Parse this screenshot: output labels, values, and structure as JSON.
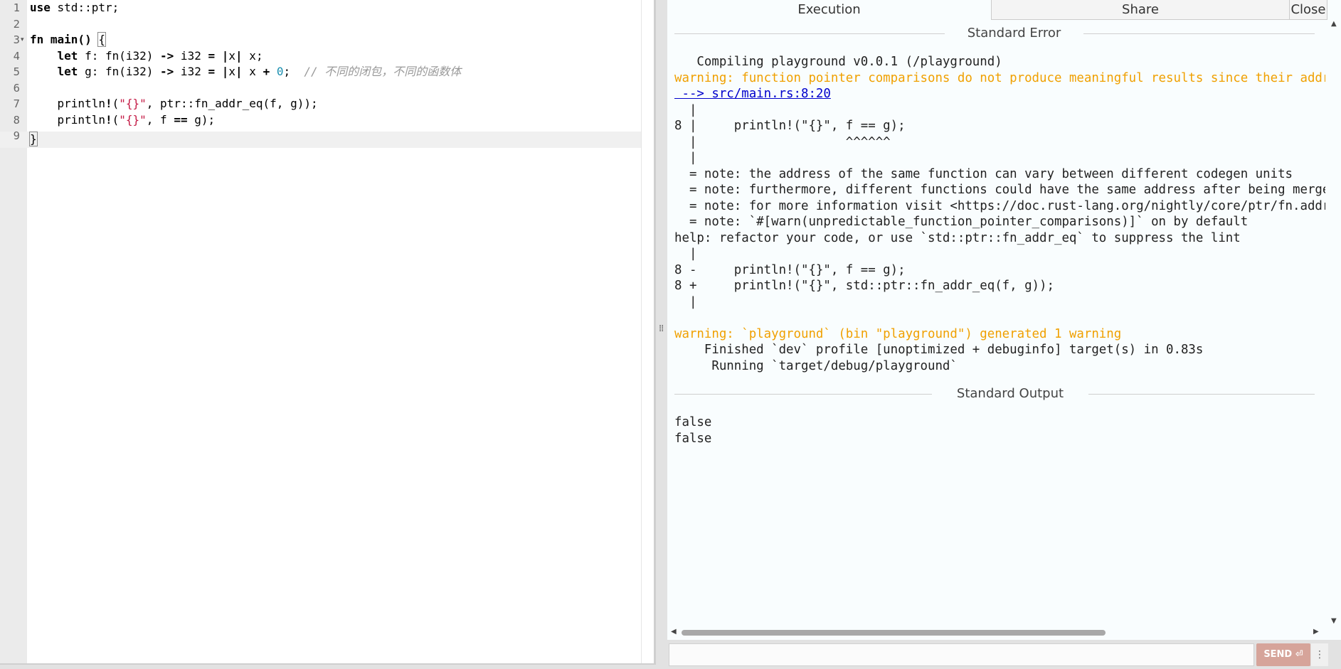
{
  "editor": {
    "line_numbers": [
      "1",
      "2",
      "3",
      "4",
      "5",
      "6",
      "7",
      "8",
      "9"
    ],
    "fold_icon": "fold-arrow-icon",
    "code": {
      "l1_kw": "use",
      "l1_rest": " std::ptr;",
      "l3_kw": "fn",
      "l3_mid": " main() ",
      "l3_brace": "{",
      "l4_indent": "    ",
      "l4_kw": "let",
      "l4_a": " f: fn(i32) ",
      "l4_arrow": "->",
      "l4_b": " i32 ",
      "l4_eq": "=",
      "l4_sp": " ",
      "l4_bar1": "|",
      "l4_x": "x",
      "l4_bar2": "|",
      "l4_c": " x;",
      "l5_indent": "    ",
      "l5_kw": "let",
      "l5_a": " g: fn(i32) ",
      "l5_arrow": "->",
      "l5_b": " i32 ",
      "l5_eq": "=",
      "l5_sp": " ",
      "l5_bar1": "|",
      "l5_x": "x",
      "l5_bar2": "|",
      "l5_c": " x ",
      "l5_plus": "+",
      "l5_sp2": " ",
      "l5_num": "0",
      "l5_semi": ";  ",
      "l5_comment": "// 不同的闭包，不同的函数体",
      "l7_a": "    println",
      "l7_bang": "!",
      "l7_paren": "(",
      "l7_str": "\"{}\"",
      "l7_rest": ", ptr::fn_addr_eq(f, g));",
      "l8_a": "    println",
      "l8_bang": "!",
      "l8_paren": "(",
      "l8_str": "\"{}\"",
      "l8_rest1": ", f ",
      "l8_eqeq": "==",
      "l8_rest2": " g);",
      "l9_brace": "}"
    }
  },
  "output": {
    "tabs": {
      "execution": "Execution",
      "share": "Share",
      "close": "Close"
    },
    "stderr_header": "Standard Error",
    "stdout_header": "Standard Output",
    "stderr_lines": [
      "   Compiling playground v0.0.1 (/playground)",
      "warning: function pointer comparisons do not produce meaningful results since their addresses are not guaranteed to be unique",
      " --> src/main.rs:8:20",
      "  |",
      "8 |     println!(\"{}\", f == g);",
      "  |                    ^^^^^^",
      "  |",
      "  = note: the address of the same function can vary between different codegen units",
      "  = note: furthermore, different functions could have the same address after being merged together",
      "  = note: for more information visit <https://doc.rust-lang.org/nightly/core/ptr/fn.addr_eq.html>",
      "  = note: `#[warn(unpredictable_function_pointer_comparisons)]` on by default",
      "help: refactor your code, or use `std::ptr::fn_addr_eq` to suppress the lint",
      "  |",
      "8 -     println!(\"{}\", f == g);",
      "8 +     println!(\"{}\", std::ptr::fn_addr_eq(f, g));",
      "  |",
      "",
      "warning: `playground` (bin \"playground\") generated 1 warning",
      "    Finished `dev` profile [unoptimized + debuginfo] target(s) in 0.83s",
      "     Running `target/debug/playground`"
    ],
    "stdout_lines": [
      "false",
      "false"
    ]
  },
  "send_bar": {
    "input_value": "",
    "send_label": "SEND",
    "send_icon": "enter-key-icon",
    "menu_icon": "vertical-dots-icon"
  },
  "colors": {
    "warning": "#f0a000",
    "string": "#c41a45",
    "number": "#1a8fb0",
    "comment": "#999999",
    "link": "#0000cc",
    "send_button": "#d6a49a"
  }
}
